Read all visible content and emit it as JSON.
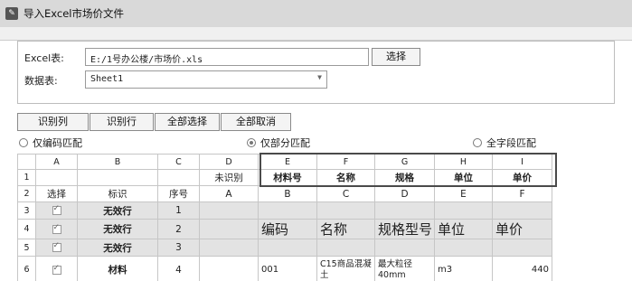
{
  "window": {
    "title": "导入Excel市场价文件",
    "icon": "app-icon"
  },
  "form": {
    "excel_label": "Excel表:",
    "excel_value": "E:/1号办公楼/市场价.xls",
    "select_button": "选择",
    "sheet_label": "数据表:",
    "sheet_value": "Sheet1"
  },
  "toolbar": {
    "identify_column": "识别列",
    "identify_row": "识别行",
    "select_all": "全部选择",
    "deselect_all": "全部取消"
  },
  "match": {
    "options": [
      "仅编码匹配",
      "仅部分匹配",
      "全字段匹配"
    ],
    "selected": "仅部分匹配"
  },
  "grid": {
    "header_cols": [
      "A",
      "B",
      "C",
      "D",
      "E",
      "F",
      "G",
      "H",
      "I"
    ],
    "row_numbers": [
      "1",
      "2",
      "3",
      "4",
      "5",
      "6"
    ],
    "row1": {
      "D": "未识别",
      "E": "材料号",
      "F": "名称",
      "G": "规格",
      "H": "单位",
      "I": "单价"
    },
    "row2": {
      "A": "选择",
      "B": "标识",
      "C": "序号",
      "D": "A",
      "E": "B",
      "F": "C",
      "G": "D",
      "H": "E",
      "I": "F"
    },
    "invalid_label": "无效行",
    "row3_seq": "1",
    "row4_seq": "2",
    "row5_seq": "3",
    "big_row": {
      "E": "编码",
      "F": "名称",
      "G": "规格型号",
      "H": "单位",
      "I": "单价"
    },
    "row6": {
      "B": "材料",
      "C": "4",
      "E": "001",
      "F": "C15商品混凝土",
      "G": "最大粒径40mm",
      "H": "m3",
      "I": "440"
    }
  }
}
